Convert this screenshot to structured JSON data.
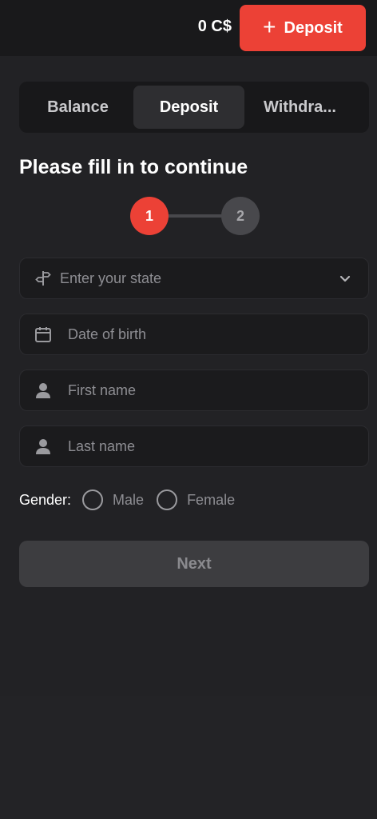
{
  "header": {
    "balance": "0 C$",
    "deposit_button": "Deposit"
  },
  "tabs": [
    {
      "label": "Balance",
      "active": false
    },
    {
      "label": "Deposit",
      "active": true
    },
    {
      "label": "Withdra...",
      "active": false
    }
  ],
  "form": {
    "title": "Please fill in to continue",
    "steps": [
      "1",
      "2"
    ],
    "current_step": 1,
    "state_placeholder": "Enter your state",
    "dob_placeholder": "Date of birth",
    "first_name_placeholder": "First name",
    "last_name_placeholder": "Last name",
    "gender_label": "Gender:",
    "gender_options": [
      "Male",
      "Female"
    ],
    "next_button": "Next"
  },
  "colors": {
    "accent": "#ec4136",
    "background": "#222225",
    "field": "#1b1b1d"
  },
  "icons": [
    "plus-icon",
    "signpost-icon",
    "chevron-down-icon",
    "calendar-icon",
    "person-icon"
  ]
}
